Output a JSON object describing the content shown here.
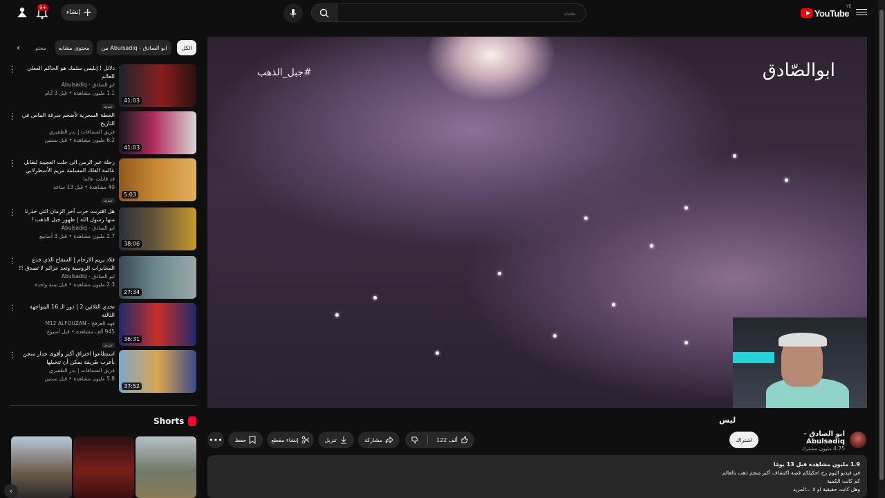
{
  "header": {
    "create_label": "إنشاء",
    "notif_badge": "9+",
    "search_placeholder": "بحث",
    "logo_text": "YouTube",
    "logo_country": "YE"
  },
  "chips": [
    {
      "label": "الكل",
      "active": true
    },
    {
      "label": "من Abulsadiq - ابو الصادق",
      "active": false
    },
    {
      "label": "محتوى مشابه",
      "active": false
    },
    {
      "label": "محتو",
      "active": false
    }
  ],
  "recommendations": [
    {
      "title": "دلائل ! إبليس سلمك هو الحاكم الفعلي للعالم",
      "channel": "ابو الصادق - Abulsadiq",
      "meta": "1.1 مليون مشاهدة • قبل 3 أيام",
      "badge": "جديد",
      "duration": "41:03",
      "verified": true
    },
    {
      "title": "الخطة السحرية لأضخم سرقة الماس في التاريخ",
      "channel": "فريق المسافات | بدر الظفيري",
      "meta": "6.2 مليون مشاهدة • قبل سنتين",
      "badge": "",
      "duration": "41:03",
      "verified": true
    },
    {
      "title": "رحلة عبر الزمن الى حلب العجيبة لنقابل عالمة الفلك المسلمة مريم الأسطرلابي",
      "channel": "قد قابلت عالما",
      "meta": "40 مشاهدة • قبل 13 ساعة",
      "badge": "جديد",
      "duration": "5:03",
      "verified": false
    },
    {
      "title": "هل اقتربت حرب آخر الزمان التي حذرنا منها رسول الله | ظهور جبل الذهب !",
      "channel": "ابو الصادق - Abulsadiq",
      "meta": "2.7 مليون مشاهدة • قبل 3 أسابيع",
      "badge": "",
      "duration": "38:06",
      "verified": true
    },
    {
      "title": "فلاد يريم الارحام | السفاح الذي خدع المخابرات الروسية وتعد جرائم لا تصدق !!",
      "channel": "ابو الصادق - Abulsadiq",
      "meta": "2.3 مليون مشاهدة • قبل سنة واحدة",
      "badge": "",
      "duration": "27:34",
      "verified": true
    },
    {
      "title": "تحدي الثلاثين 2 | دور الـ 16 المواجهة الثالثة",
      "channel": "فهد العرفج - M12 ALFOUZAN",
      "meta": "945 ألف مشاهدة • قبل أسبوع",
      "badge": "جديد",
      "duration": "36:31",
      "verified": false
    },
    {
      "title": "استطاعوا اختراق أكبر وأقوى جدار سجن بأغرب طريقة يمكن أن تتخيلها",
      "channel": "فريق المسافات | بدر الظفيري",
      "meta": "5.8 مليون مشاهدة • قبل سنتين",
      "badge": "",
      "duration": "37:52",
      "verified": true
    }
  ],
  "shorts": {
    "heading": "Shorts"
  },
  "player": {
    "watermark_channel": "ابوالصّادق",
    "watermark_tag": "#جبل_الذهب"
  },
  "video": {
    "title_fragment": "ليس",
    "channel_name": "ابو الصادق - Abulsadiq",
    "subscribers": "4.75 مليون مشترك",
    "subscribe_label": "اشتراك",
    "like_count": "122 ألف",
    "share_label": "مشاركة",
    "download_label": "تنزيل",
    "clip_label": "إنشاء مقطع",
    "save_label": "حفظ"
  },
  "description": {
    "stats": "1.9 مليون مشاهدة  قبل 13 يومًا",
    "lines": [
      "في فيديو اليوم رح احكيلكم قصة اكتشاف أكبر منجم ذهب بالعالم",
      "كم كانت الكمية",
      "وهل كانت حقيقية او لا ...المزيد"
    ]
  },
  "colors": {
    "accent": "#ff0000",
    "bg": "#0f0f0f",
    "chip": "#272727"
  }
}
